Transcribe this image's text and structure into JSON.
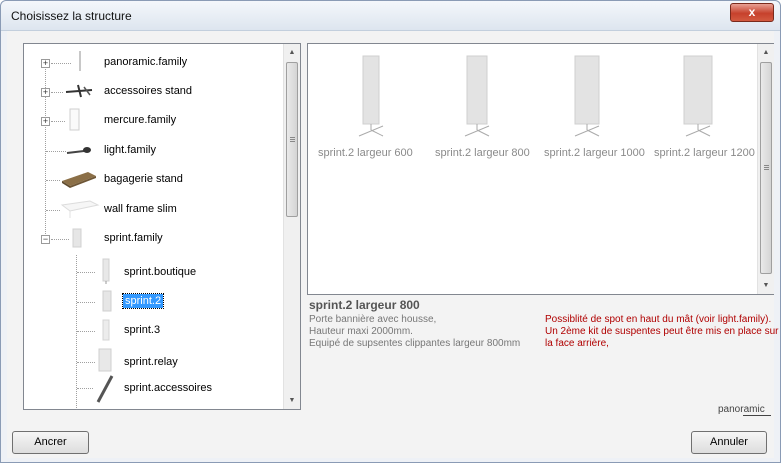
{
  "window": {
    "title": "Choisissez la structure",
    "close_glyph": "x"
  },
  "tree": {
    "items": [
      {
        "label": "panoramic.family",
        "expandable": true,
        "expanded": false
      },
      {
        "label": "accessoires stand",
        "expandable": true,
        "expanded": false
      },
      {
        "label": "mercure.family",
        "expandable": true,
        "expanded": false
      },
      {
        "label": "light.family",
        "expandable": false
      },
      {
        "label": "bagagerie stand",
        "expandable": false
      },
      {
        "label": "wall frame slim",
        "expandable": false
      },
      {
        "label": "sprint.family",
        "expandable": true,
        "expanded": true
      }
    ],
    "children": [
      {
        "label": "sprint.boutique",
        "selected": false
      },
      {
        "label": "sprint.2",
        "selected": true
      },
      {
        "label": "sprint.3",
        "selected": false
      },
      {
        "label": "sprint.relay",
        "selected": false
      },
      {
        "label": "sprint.accessoires",
        "selected": false
      }
    ]
  },
  "gallery": {
    "items": [
      {
        "label": "sprint.2 largeur 600"
      },
      {
        "label": "sprint.2 largeur 800"
      },
      {
        "label": "sprint.2 largeur 1000"
      },
      {
        "label": "sprint.2 largeur 1200"
      }
    ]
  },
  "detail": {
    "title": "sprint.2 largeur 800",
    "desc_lines": [
      "Porte bannière avec housse,",
      "Hauteur maxi 2000mm.",
      "Equipé de supsentes clippantes largeur 800mm"
    ],
    "note_lines": [
      "Possiblité de spot en haut du mât (voir light.family).",
      "Un 2ème kit de suspentes peut être mis en place sur",
      "la face arrière,"
    ]
  },
  "logo_text": "panoramic",
  "buttons": {
    "left": "Ancrer",
    "right": "Annuler"
  },
  "colors": {
    "selection": "#3399ff",
    "note": "#b00000",
    "close": "#c6412c"
  }
}
